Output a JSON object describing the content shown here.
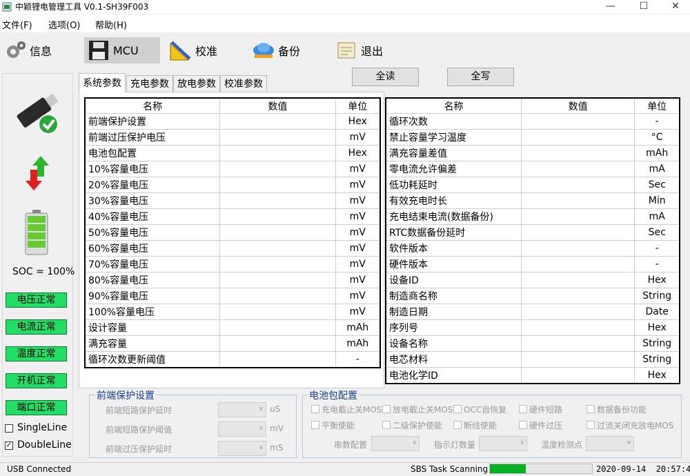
{
  "window": {
    "title": "中颖锂电管理工具 V0.1-SH39F003",
    "minimize": "—",
    "maximize": "☐",
    "close": "✕"
  },
  "menu": [
    "文件(F)",
    "选项(O)",
    "帮助(H)"
  ],
  "toolbar": [
    {
      "label": "信息",
      "icon": "gear-icon"
    },
    {
      "label": "MCU",
      "icon": "floppy-icon",
      "active": true
    },
    {
      "label": "校准",
      "icon": "ruler-icon"
    },
    {
      "label": "备份",
      "icon": "cloud-icon"
    },
    {
      "label": "退出",
      "icon": "exit-icon"
    }
  ],
  "left": {
    "soc": "SOC = 100%",
    "statuses": [
      "电压正常",
      "电流正常",
      "温度正常",
      "开机正常",
      "端口正常"
    ],
    "single_line": "SingleLine",
    "single_checked": false,
    "double_line": "DoubleLine",
    "double_checked": true,
    "status_color": "#22dd66"
  },
  "tabs": [
    "系统参数",
    "充电参数",
    "放电参数",
    "校准参数"
  ],
  "actions": {
    "read_all": "全读",
    "write_all": "全写"
  },
  "table_headers": {
    "name": "名称",
    "value": "数值",
    "unit": "单位"
  },
  "left_table": [
    {
      "name": "前端保护设置",
      "value": "",
      "unit": "Hex"
    },
    {
      "name": "前端过压保护电压",
      "value": "",
      "unit": "mV"
    },
    {
      "name": "电池包配置",
      "value": "",
      "unit": "Hex"
    },
    {
      "name": "10%容量电压",
      "value": "",
      "unit": "mV"
    },
    {
      "name": "20%容量电压",
      "value": "",
      "unit": "mV"
    },
    {
      "name": "30%容量电压",
      "value": "",
      "unit": "mV"
    },
    {
      "name": "40%容量电压",
      "value": "",
      "unit": "mV"
    },
    {
      "name": "50%容量电压",
      "value": "",
      "unit": "mV"
    },
    {
      "name": "60%容量电压",
      "value": "",
      "unit": "mV"
    },
    {
      "name": "70%容量电压",
      "value": "",
      "unit": "mV"
    },
    {
      "name": "80%容量电压",
      "value": "",
      "unit": "mV"
    },
    {
      "name": "90%容量电压",
      "value": "",
      "unit": "mV"
    },
    {
      "name": "100%容量电压",
      "value": "",
      "unit": "mV"
    },
    {
      "name": "设计容量",
      "value": "",
      "unit": "mAh"
    },
    {
      "name": "满充容量",
      "value": "",
      "unit": "mAh"
    },
    {
      "name": "循环次数更新阈值",
      "value": "",
      "unit": "-"
    }
  ],
  "right_table": [
    {
      "name": "循环次数",
      "value": "",
      "unit": "-"
    },
    {
      "name": "禁止容量学习温度",
      "value": "",
      "unit": "°C"
    },
    {
      "name": "满充容量差值",
      "value": "",
      "unit": "mAh"
    },
    {
      "name": "零电流允许偏差",
      "value": "",
      "unit": "mA"
    },
    {
      "name": "低功耗延时",
      "value": "",
      "unit": "Sec"
    },
    {
      "name": "有效充电时长",
      "value": "",
      "unit": "Min"
    },
    {
      "name": "充电结束电流(数据备份)",
      "value": "",
      "unit": "mA"
    },
    {
      "name": "RTC数据备份延时",
      "value": "",
      "unit": "Sec"
    },
    {
      "name": "软件版本",
      "value": "",
      "unit": "-"
    },
    {
      "name": "硬件版本",
      "value": "",
      "unit": "-"
    },
    {
      "name": "设备ID",
      "value": "",
      "unit": "Hex"
    },
    {
      "name": "制造商名称",
      "value": "",
      "unit": "String"
    },
    {
      "name": "制造日期",
      "value": "",
      "unit": "Date"
    },
    {
      "name": "序列号",
      "value": "",
      "unit": "Hex"
    },
    {
      "name": "设备名称",
      "value": "",
      "unit": "String"
    },
    {
      "name": "电芯材料",
      "value": "",
      "unit": "String"
    },
    {
      "name": "电池化学ID",
      "value": "",
      "unit": "Hex"
    }
  ],
  "frontend_group": {
    "title": "前端保护设置",
    "rows": [
      {
        "label": "前端短路保护延时",
        "unit": "uS"
      },
      {
        "label": "前端短路保护阈值",
        "unit": "mV"
      },
      {
        "label": "前端过压保护延时",
        "unit": "mS"
      }
    ]
  },
  "pack_group": {
    "title": "电池包配置",
    "checks_row1": [
      "充电截止关MOS",
      "放电截止关MOS",
      "OCC自恢复",
      "硬件短路",
      "数据备份功能"
    ],
    "checks_row2": [
      "平衡使能",
      "二级保护使能",
      "断线使能",
      "硬件过压",
      "过流关闭充放电MOS"
    ],
    "combos": [
      "串数配置",
      "指示灯数量",
      "温度检测点"
    ]
  },
  "status": {
    "connection": "USB Connected",
    "task": "SBS Task Scanning",
    "progress": 0.35,
    "datetime": "2020-09-14  20:57:43",
    "progress_color": "#06b025"
  }
}
